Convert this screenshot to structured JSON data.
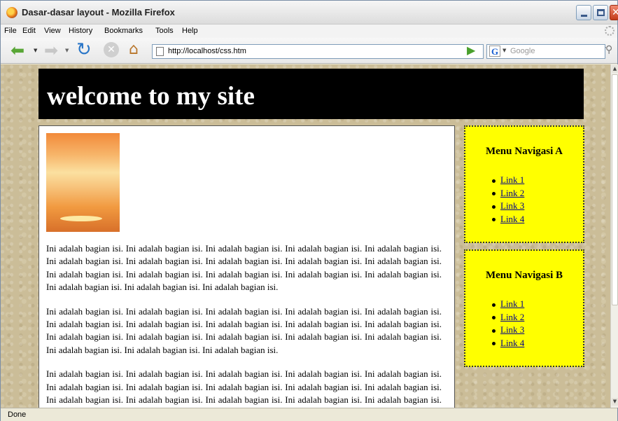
{
  "window": {
    "title": "Dasar-dasar layout - Mozilla Firefox"
  },
  "menu": [
    "File",
    "Edit",
    "View",
    "History",
    "Bookmarks",
    "Tools",
    "Help"
  ],
  "navigation": {
    "url": "http://localhost/css.htm",
    "search_placeholder": "Google",
    "search_engine_letter": "G"
  },
  "page": {
    "site_title": "welcome to my site",
    "paragraph": "Ini adalah bagian isi. Ini adalah bagian isi. Ini adalah bagian isi. Ini adalah bagian isi. Ini adalah bagian isi. Ini adalah bagian isi. Ini adalah bagian isi. Ini adalah bagian isi. Ini adalah bagian isi. Ini adalah bagian isi. Ini adalah bagian isi. Ini adalah bagian isi. Ini adalah bagian isi. Ini adalah bagian isi. Ini adalah bagian isi. Ini adalah bagian isi. Ini adalah bagian isi. Ini adalah bagian isi.",
    "menus": [
      {
        "title": "Menu Navigasi A",
        "links": [
          "Link 1",
          "Link 2",
          "Link 3",
          "Link 4"
        ]
      },
      {
        "title": "Menu Navigasi B",
        "links": [
          "Link 1",
          "Link 2",
          "Link 3",
          "Link 4"
        ]
      }
    ]
  },
  "status": "Done"
}
